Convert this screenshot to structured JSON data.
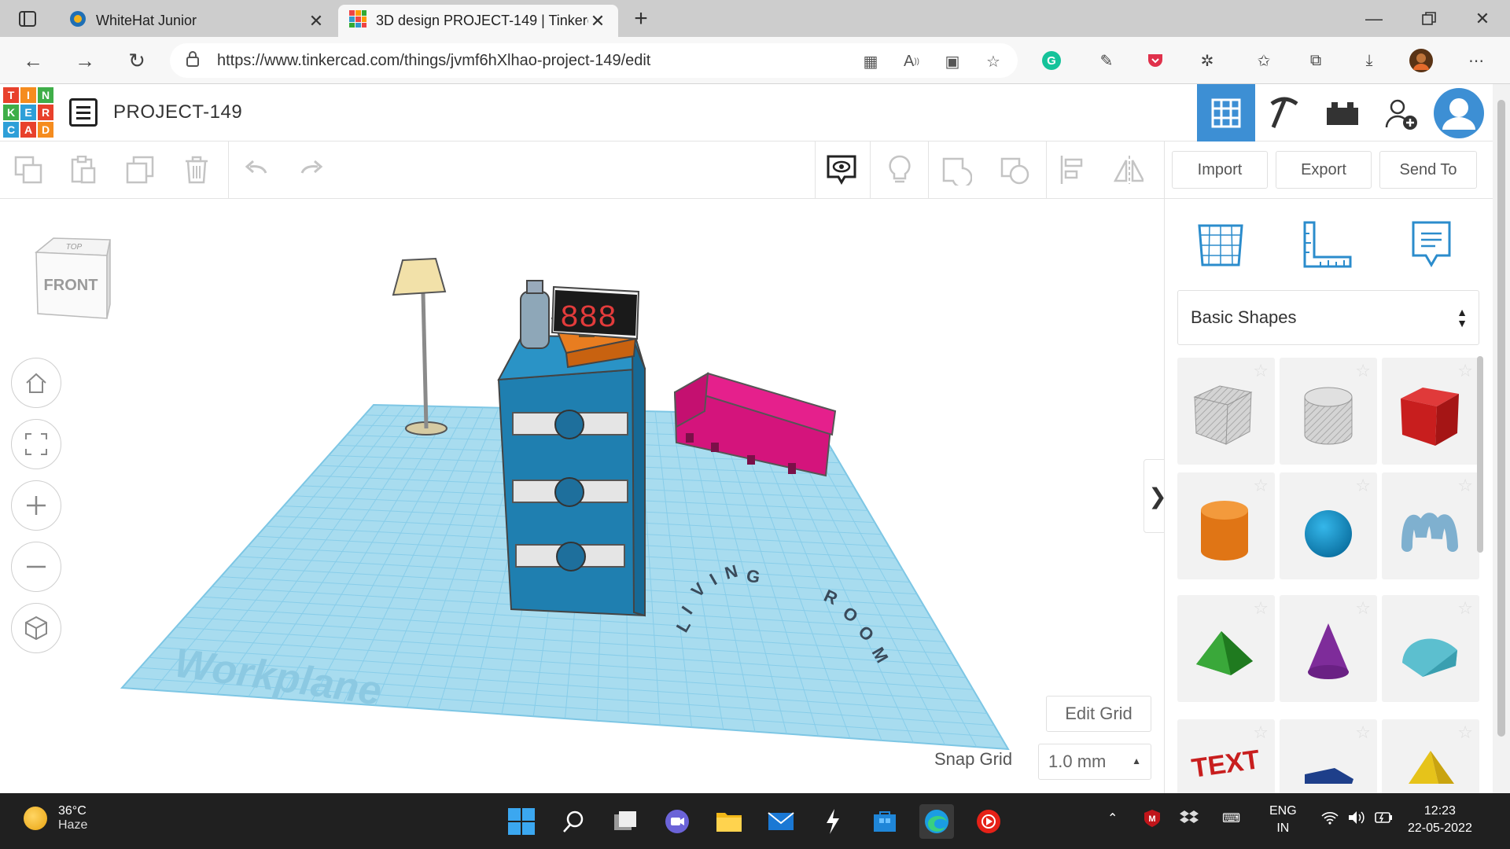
{
  "browser": {
    "tabs": [
      {
        "title": "WhiteHat Junior",
        "active": false
      },
      {
        "title": "3D design PROJECT-149 | Tinkercad",
        "active": true
      }
    ],
    "url": "https://www.tinkercad.com/things/jvmf6hXlhao-project-149/edit"
  },
  "header": {
    "logo_letters": [
      "T",
      "I",
      "N",
      "K",
      "E",
      "R",
      "C",
      "A",
      "D"
    ],
    "project_title": "PROJECT-149"
  },
  "toolbar": {
    "import_label": "Import",
    "export_label": "Export",
    "send_to_label": "Send To"
  },
  "viewport": {
    "viewcube_top": "TOP",
    "viewcube_front": "FRONT",
    "workplane_label": "Workplane",
    "edit_grid_label": "Edit Grid",
    "snap_grid_label": "Snap Grid",
    "snap_grid_value": "1.0 mm",
    "scene_text": "LIVING ROOM"
  },
  "panel": {
    "category": "Basic Shapes",
    "shapes": [
      "box-hole-icon",
      "cylinder-hole-icon",
      "box-icon",
      "cylinder-icon",
      "sphere-icon",
      "scribble-icon",
      "roof-icon",
      "cone-icon",
      "round-roof-icon",
      "text-icon",
      "polygon-icon",
      "pyramid-icon"
    ]
  },
  "taskbar": {
    "temperature": "36°C",
    "weather": "Haze",
    "language_top": "ENG",
    "language_bottom": "IN",
    "time": "12:23",
    "date": "22-05-2022"
  },
  "colors": {
    "tinker_blue": "#3d8fd4",
    "workplane": "#a8dcef",
    "cabinet": "#1f7fb0",
    "sofa": "#d4147c"
  }
}
